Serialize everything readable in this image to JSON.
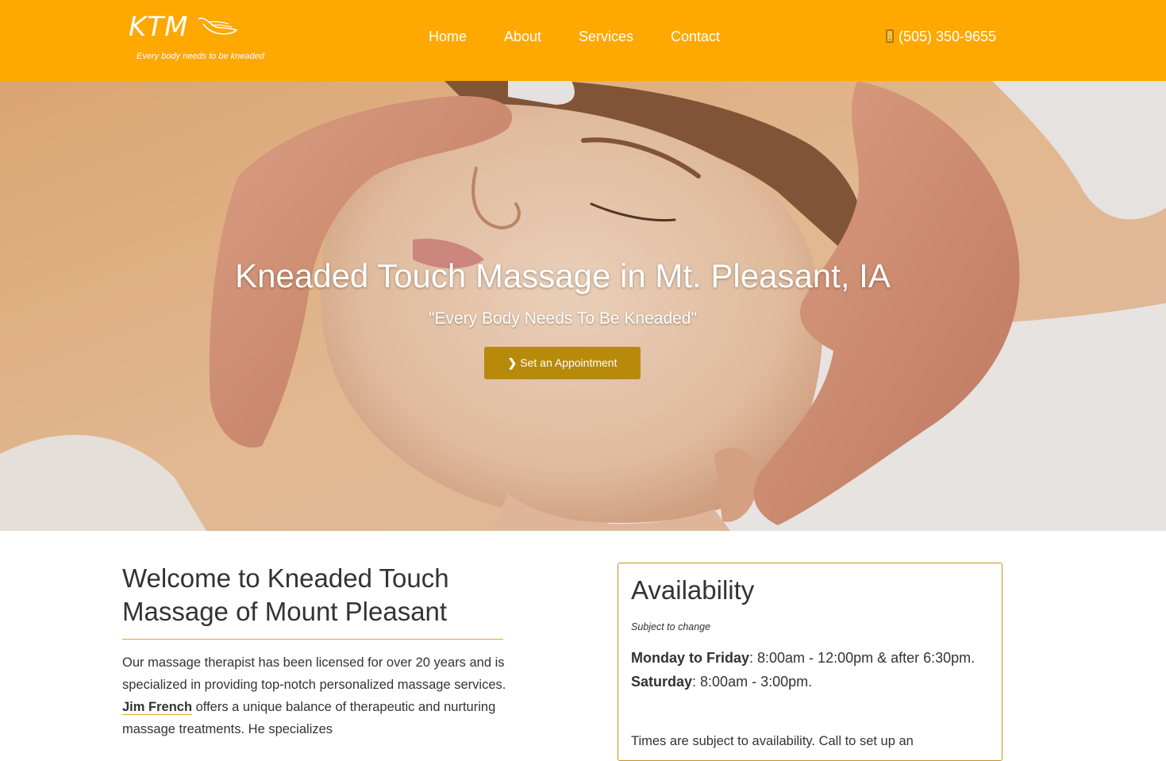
{
  "brand": {
    "logo_text": "KTM",
    "tagline": "Every body needs to be kneaded",
    "color": "#ffa800"
  },
  "nav": {
    "items": [
      "Home",
      "About",
      "Services",
      "Contact"
    ],
    "phone": "(505) 350-9655",
    "phone_icon": "mobile-phone-icon"
  },
  "hero": {
    "title": "Kneaded Touch Massage in Mt. Pleasant, IA",
    "subtitle": "\"Every Body Needs To Be Kneaded\"",
    "button_label": "Set an Appointment",
    "button_icon": "chevron-right-icon",
    "button_color": "#b88a0b"
  },
  "welcome": {
    "title": "Welcome to Kneaded Touch Massage of Mount Pleasant",
    "body_1": "Our massage therapist has been licensed for over 20 years and is specialized in providing top-notch personalized massage services. ",
    "link": "Jim French",
    "body_2": " offers a unique balance of therapeutic and nurturing massage treatments. He specializes"
  },
  "availability": {
    "title": "Availability",
    "note": "Subject to change",
    "weekday_label": "Monday to Friday",
    "weekday_hours": ": 8:00am - 12:00pm & after 6:30pm.",
    "saturday_label": "Saturday",
    "saturday_hours": ": 8:00am - 3:00pm.",
    "footer": "Times are subject to availability. Call to set up an"
  }
}
